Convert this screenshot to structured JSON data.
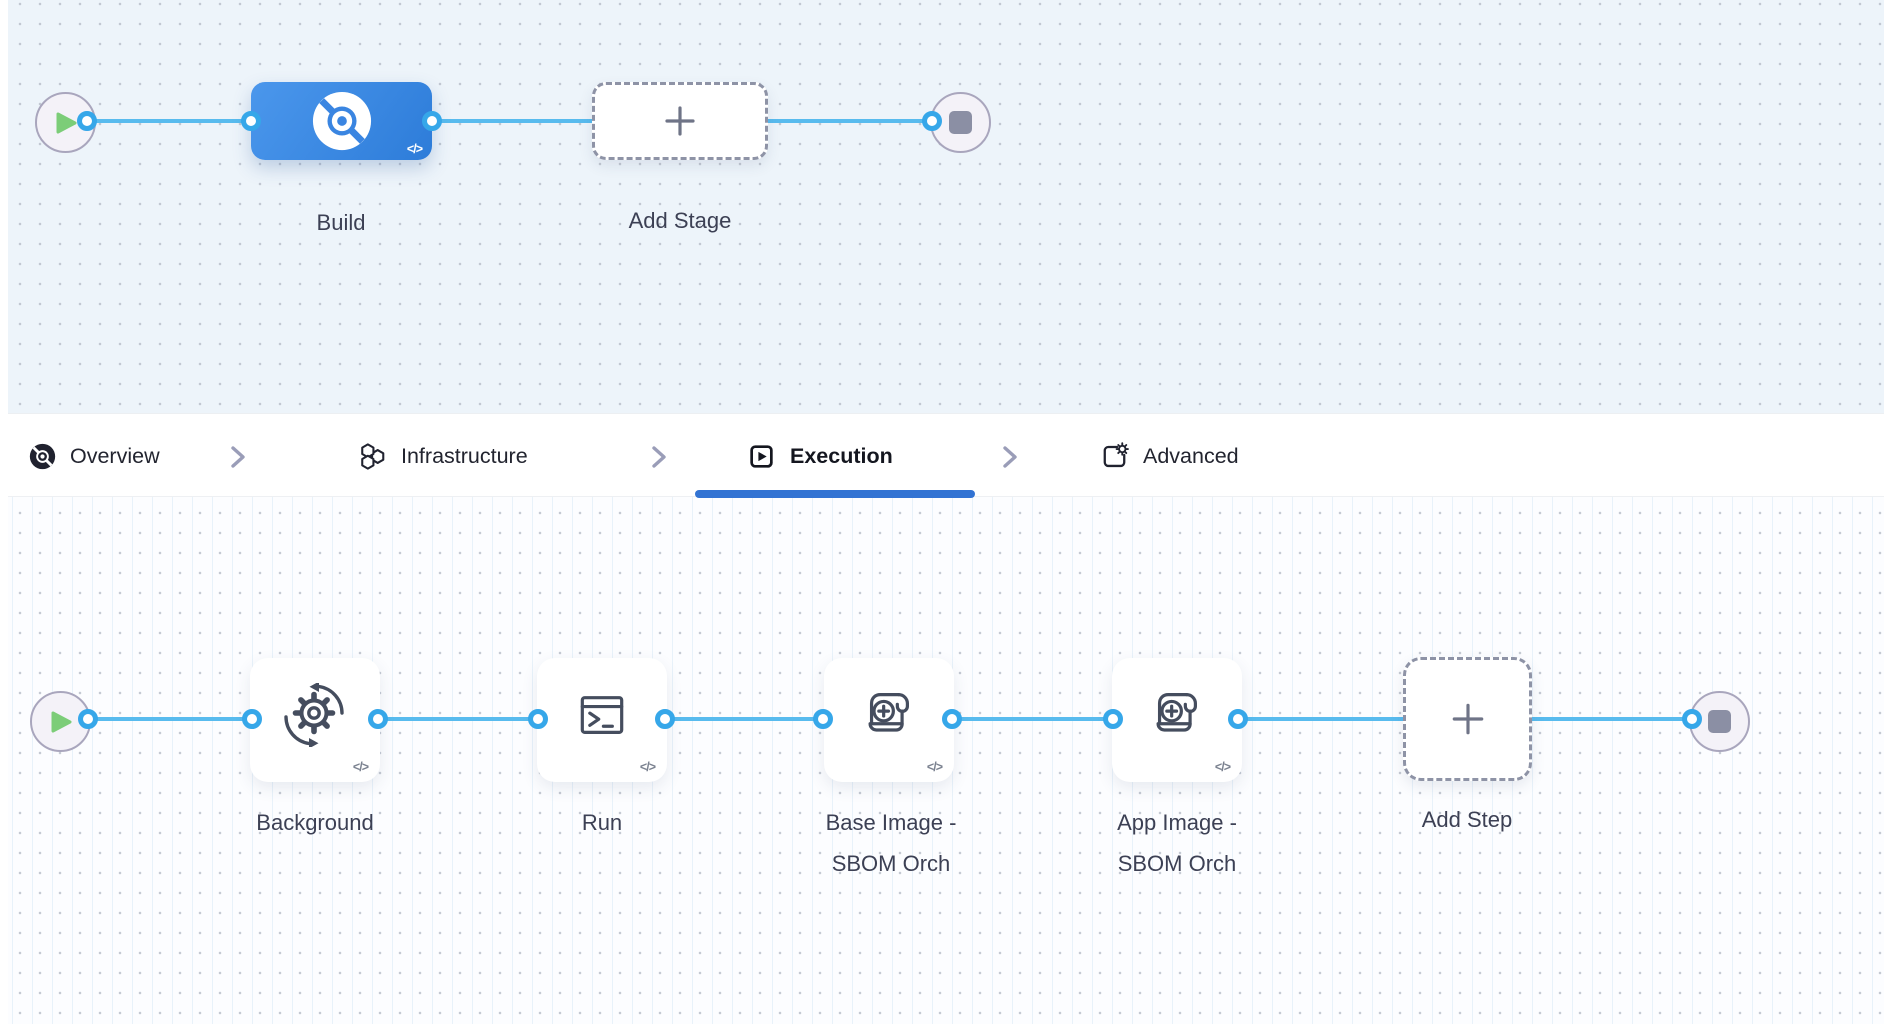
{
  "stage_graph": {
    "stages": [
      {
        "label": "Build",
        "icon": "ci-build-icon",
        "code_badge": "</>"
      }
    ],
    "add_stage_label": "Add Stage",
    "start_icon": "play-icon",
    "end_icon": "stop-icon"
  },
  "tabs": [
    {
      "label": "Overview",
      "icon": "ci-overview-icon",
      "active": false
    },
    {
      "label": "Infrastructure",
      "icon": "infrastructure-hexagons-icon",
      "active": false
    },
    {
      "label": "Execution",
      "icon": "execution-play-icon",
      "active": true
    },
    {
      "label": "Advanced",
      "icon": "advanced-settings-icon",
      "active": false
    }
  ],
  "execution_graph": {
    "steps": [
      {
        "label": "Background",
        "icon": "background-sync-gear-icon",
        "code_badge": "</>"
      },
      {
        "label": "Run",
        "icon": "run-terminal-icon",
        "code_badge": "</>"
      },
      {
        "label": "Base Image - SBOM Orch",
        "icon": "sbom-scroll-plus-icon",
        "code_badge": "</>"
      },
      {
        "label": "App Image - SBOM Orch",
        "icon": "sbom-scroll-plus-icon",
        "code_badge": "</>"
      }
    ],
    "add_step_label": "Add Step",
    "start_icon": "play-icon",
    "end_icon": "stop-icon"
  },
  "colors": {
    "accent_blue": "#3273d3",
    "link_blue": "#58bbee",
    "port_ring_blue": "#36a7e9",
    "stage_blue": "#3a86e2",
    "play_green": "#7ccd78",
    "node_gray": "#8b8fa4",
    "icon_slate": "#454d5e",
    "label_slate": "#3c4054"
  }
}
